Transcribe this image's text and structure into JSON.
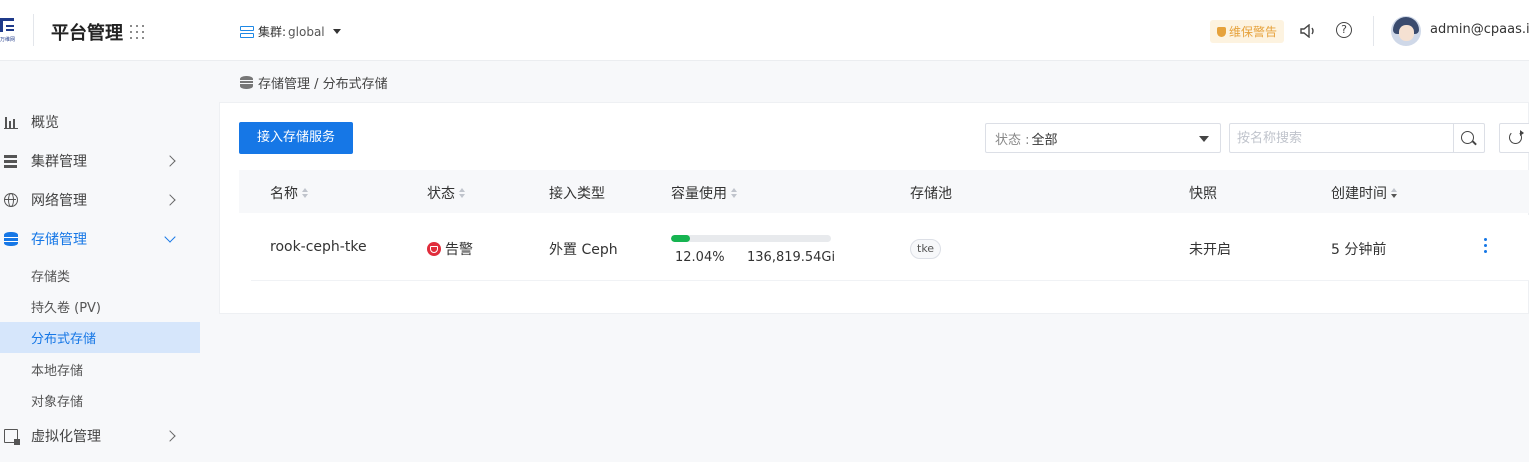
{
  "header": {
    "logo_text": "万维网",
    "title": "平台管理",
    "cluster_label": "集群:",
    "cluster_value": "global",
    "warn_badge": "维保警告",
    "username": "admin@cpaas.io"
  },
  "sidebar": {
    "items": [
      {
        "label": "概览",
        "icon": "bar-chart-icon"
      },
      {
        "label": "集群管理",
        "icon": "server-icon"
      },
      {
        "label": "网络管理",
        "icon": "globe-icon"
      },
      {
        "label": "存储管理",
        "icon": "database-icon"
      },
      {
        "label": "虚拟化管理",
        "icon": "vm-icon"
      }
    ],
    "storage_sub": [
      {
        "label": "存储类"
      },
      {
        "label": "持久卷 (PV)"
      },
      {
        "label": "分布式存储"
      },
      {
        "label": "本地存储"
      },
      {
        "label": "对象存储"
      }
    ]
  },
  "breadcrumb": "存储管理 / 分布式存储",
  "toolbar": {
    "add_button": "接入存储服务",
    "status_label": "状态 :",
    "status_value": "全部",
    "search_placeholder": "按名称搜索"
  },
  "table": {
    "columns": [
      "名称",
      "状态",
      "接入类型",
      "容量使用",
      "存储池",
      "快照",
      "创建时间"
    ],
    "rows": [
      {
        "name": "rook-ceph-tke",
        "status": "告警",
        "type": "外置 Ceph",
        "usage_percent": "12.04%",
        "usage_fraction": 0.1204,
        "capacity": "136,819.54Gi",
        "pool": "tke",
        "snapshot": "未开启",
        "created": "5 分钟前"
      }
    ]
  },
  "colors": {
    "primary": "#1677e6",
    "success": "#16b451",
    "danger": "#e02d3c",
    "warning": "#e6a23c"
  }
}
